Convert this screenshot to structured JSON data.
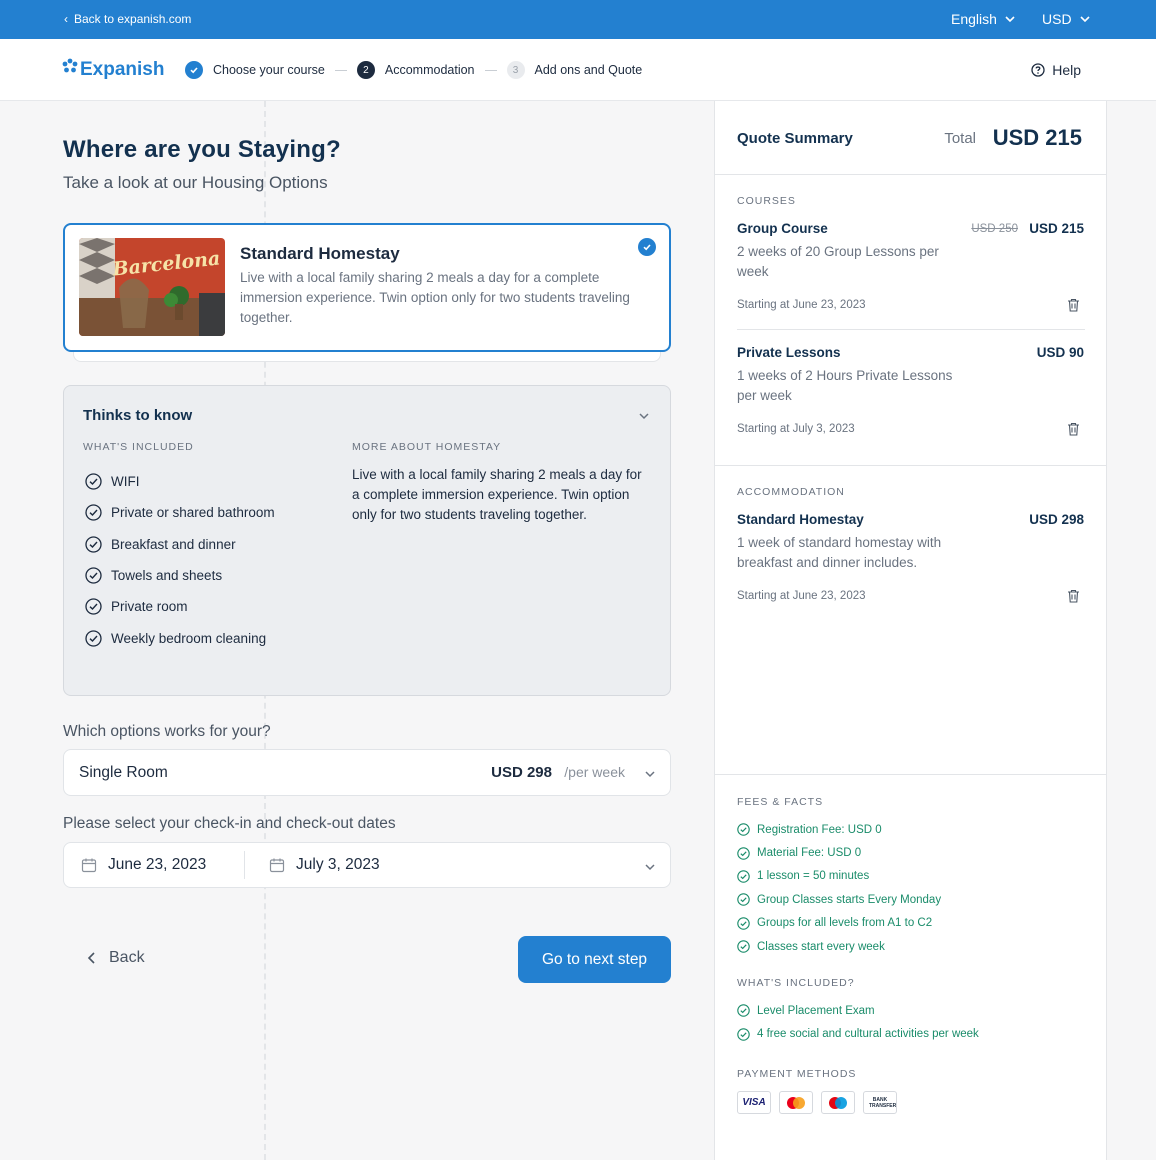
{
  "topbar": {
    "back_label": "Back to expanish.com",
    "language": "English",
    "currency": "USD"
  },
  "nav": {
    "logo_text": "Expanish",
    "steps": [
      {
        "number": "",
        "label": "Choose your course",
        "state": "done"
      },
      {
        "number": "2",
        "label": "Accommodation",
        "state": "active"
      },
      {
        "number": "3",
        "label": "Add ons and Quote",
        "state": "todo"
      }
    ],
    "help_label": "Help"
  },
  "page": {
    "title": "Where are you Staying?",
    "subtitle": "Take a look at our Housing Options"
  },
  "housing": {
    "image_sign": "Barcelona",
    "title": "Standard Homestay",
    "description": "Live with a local family sharing 2 meals a day for a complete immersion experience. Twin option only for two students traveling together."
  },
  "know": {
    "title": "Thinks to know",
    "included_heading": "WHAT'S INCLUDED",
    "included": [
      "WIFI",
      "Private or shared bathroom",
      "Breakfast and dinner",
      "Towels and sheets",
      "Private room",
      "Weekly bedroom cleaning"
    ],
    "more_heading": "MORE ABOUT HOMESTAY",
    "more_text": "Live with a local family sharing 2 meals a day for a complete immersion experience. Twin option only for two students traveling together."
  },
  "options": {
    "question": "Which options works for your?",
    "selected": "Single Room",
    "price": "USD 298",
    "per": "/per week"
  },
  "dates": {
    "question": "Please select your check-in and check-out dates",
    "check_in": "June 23, 2023",
    "check_out": "July 3, 2023"
  },
  "actions": {
    "back": "Back",
    "next": "Go to next step"
  },
  "quote": {
    "title": "Quote Summary",
    "total_label": "Total",
    "total": "USD 215",
    "courses_heading": "COURSES",
    "courses": [
      {
        "name": "Group Course",
        "old_price": "USD 250",
        "price": "USD 215",
        "desc": "2 weeks of 20 Group Lessons per week",
        "start": "Starting at June 23, 2023"
      },
      {
        "name": "Private Lessons",
        "old_price": "",
        "price": "USD 90",
        "desc": "1 weeks of 2 Hours Private Lessons per week",
        "start": "Starting at July 3, 2023"
      }
    ],
    "accommodation_heading": "ACCOMMODATION",
    "accommodation": {
      "name": "Standard Homestay",
      "price": "USD 298",
      "desc": "1 week of standard homestay with breakfast and dinner includes.",
      "start": "Starting at June 23, 2023"
    },
    "fees_heading": "FEES & FACTS",
    "fees": [
      "Registration Fee: USD 0",
      "Material Fee: USD 0",
      "1 lesson = 50 minutes",
      "Group Classes starts Every Monday",
      "Groups for all levels from A1 to C2",
      "Classes start every week"
    ],
    "included_heading": "WHAT'S INCLUDED?",
    "included": [
      "Level Placement Exam",
      "4 free social and cultural activities per week"
    ],
    "payment_heading": "PAYMENT METHODS",
    "payment_methods": [
      "VISA",
      "Mastercard",
      "Maestro",
      "BANK TRANSFER"
    ]
  },
  "colors": {
    "primary": "#2380d0",
    "navy": "#13314f",
    "success": "#1a8c6a"
  }
}
